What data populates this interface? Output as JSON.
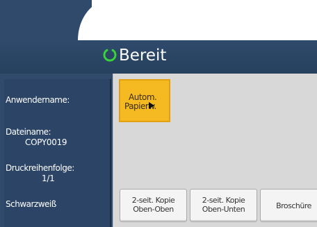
{
  "status": {
    "text": "Bereit",
    "icon": "ready-ring-icon",
    "icon_color": "#3ad13a"
  },
  "side_panel": {
    "user_label": "Anwendername:",
    "file_label": "Dateiname:",
    "file_value": "COPY0019",
    "print_order_label": "Druckreihenfolge:",
    "print_order_value": "1/1",
    "color_mode": "Schwarzweiß"
  },
  "buttons": {
    "auto_paper_line1": "Autom.",
    "auto_paper_line2": "Papierw.",
    "duplex_top_top_line1": "2-seit. Kopie",
    "duplex_top_top_line2": "Oben-Oben",
    "duplex_top_bottom_line1": "2-seit. Kopie",
    "duplex_top_bottom_line2": "Oben-Unten",
    "booklet": "Broschüre"
  },
  "colors": {
    "header_navy": "#2f4a6b",
    "content_gray": "#d8d8d8",
    "selected_yellow": "#f5b921"
  }
}
